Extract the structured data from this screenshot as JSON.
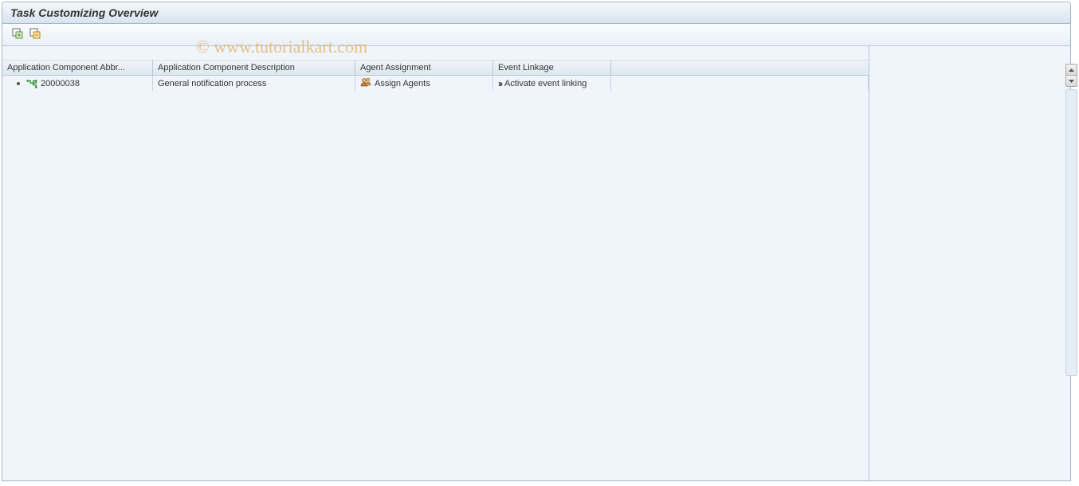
{
  "window": {
    "title": "Task Customizing Overview"
  },
  "toolbar": {
    "expand_all_title": "Expand All",
    "collapse_all_title": "Collapse All"
  },
  "table": {
    "headers": {
      "col1": "Application Component Abbr...",
      "col2": "Application Component Description",
      "col3": "Agent Assignment",
      "col4": "Event Linkage"
    },
    "rows": [
      {
        "abbr": "20000038",
        "desc": "General notification process",
        "agent": "Assign Agents",
        "event": "Activate event linking"
      }
    ]
  },
  "watermark": "© www.tutorialkart.com"
}
